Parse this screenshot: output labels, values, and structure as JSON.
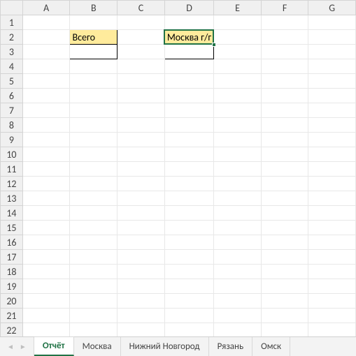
{
  "columns": [
    "A",
    "B",
    "C",
    "D",
    "E",
    "F",
    "G"
  ],
  "row_count": 23,
  "active_cell": "D2",
  "cells": {
    "B2": {
      "value": "Всего",
      "fill": "shade",
      "border": "black"
    },
    "B3": {
      "value": "",
      "fill": "none",
      "border": "black"
    },
    "D2": {
      "value": "Москва г/г",
      "fill": "shade",
      "border": "black"
    },
    "D3": {
      "value": "",
      "fill": "none",
      "border": "black"
    }
  },
  "tabs": [
    {
      "label": "Отчёт",
      "active": true
    },
    {
      "label": "Москва",
      "active": false
    },
    {
      "label": "Нижний Новгород",
      "active": false
    },
    {
      "label": "Рязань",
      "active": false
    },
    {
      "label": "Омск",
      "active": false
    }
  ],
  "nav": {
    "prev": "◄",
    "next": "►"
  }
}
